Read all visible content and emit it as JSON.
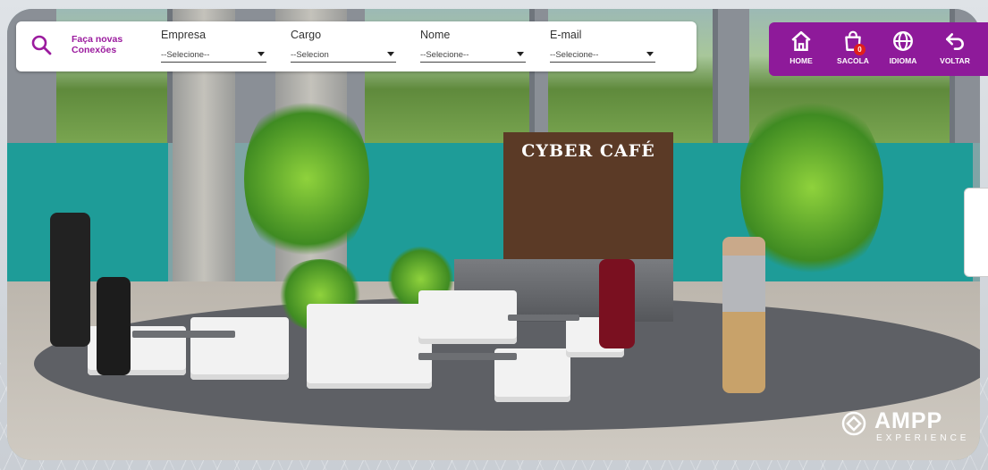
{
  "search": {
    "label": "Faça novas\nConexões",
    "filters": [
      {
        "label": "Empresa",
        "value": "--Selecione--"
      },
      {
        "label": "Cargo",
        "value": "--Selecion"
      },
      {
        "label": "Nome",
        "value": "--Selecione--"
      },
      {
        "label": "E-mail",
        "value": "--Selecione--"
      }
    ]
  },
  "nav": {
    "home": "HOME",
    "sacola": "SACOLA",
    "sacola_count": "0",
    "idioma": "IDIOMA",
    "voltar": "VOLTAR"
  },
  "scene": {
    "sign": "CYBER CAFÉ"
  },
  "brand": {
    "name": "AMPP",
    "sub": "EXPERIENCE"
  },
  "colors": {
    "accent": "#8e1a9a",
    "badge": "#e0201b"
  }
}
